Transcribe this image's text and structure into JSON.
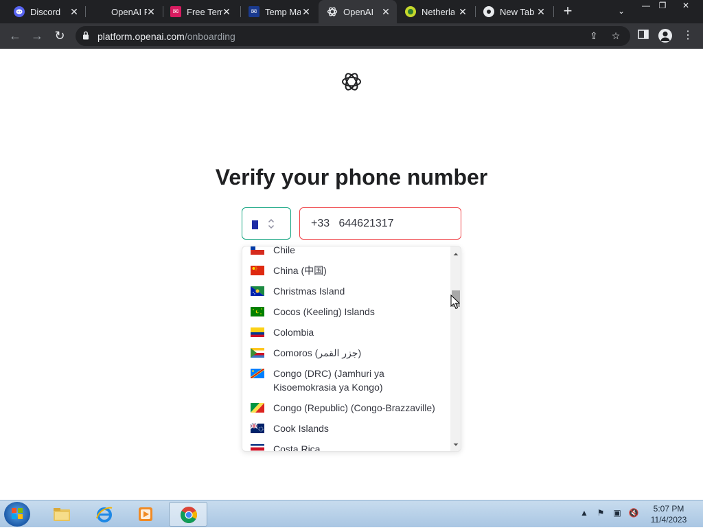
{
  "browser": {
    "tabs": [
      {
        "title": "Discord",
        "icon": "discord-icon",
        "icon_color": "#5865f2"
      },
      {
        "title": "OpenAI Platform",
        "icon": "openai-icon",
        "icon_color": "#202124"
      },
      {
        "title": "Free Temp Mail",
        "icon": "temp-mail-icon",
        "icon_color": "#d81b60"
      },
      {
        "title": "Temp Mail",
        "icon": "temp-mail-icon",
        "icon_color": "#1a3a8f"
      },
      {
        "title": "OpenAI Platform",
        "icon": "openai-icon",
        "icon_color": "#35363a"
      },
      {
        "title": "Netherlands",
        "icon": "globe-icon",
        "icon_color": "#c6d82c"
      },
      {
        "title": "New Tab",
        "icon": "chrome-icon",
        "icon_color": "#e8eaed"
      }
    ],
    "active_tab_index": 4,
    "address": {
      "host": "platform.openai.com",
      "path": "/onboarding"
    }
  },
  "page": {
    "heading": "Verify your phone number",
    "selected_country": "France",
    "phone_value": "+33   644621317",
    "countries": [
      {
        "name": "Chile",
        "flag_colors": [
          "#0039a6",
          "#ffffff",
          "#d52b1e"
        ]
      },
      {
        "name": "China (中国)",
        "flag_colors": [
          "#de2910",
          "#ffde00"
        ]
      },
      {
        "name": "Christmas Island",
        "flag_colors": [
          "#0021ad",
          "#1c8a42",
          "#ffc639"
        ]
      },
      {
        "name": "Cocos (Keeling) Islands",
        "flag_colors": [
          "#008000",
          "#ffe000"
        ]
      },
      {
        "name": "Colombia",
        "flag_colors": [
          "#fcd116",
          "#003893",
          "#ce1126"
        ]
      },
      {
        "name": "Comoros (جزر القمر)",
        "flag_colors": [
          "#ffc61e",
          "#ffffff",
          "#ce1126",
          "#3a75c4",
          "#3d8e33"
        ]
      },
      {
        "name": "Congo (DRC) (Jamhuri ya Kisoemokrasia ya Kongo)",
        "flag_colors": [
          "#007fff",
          "#f7d618",
          "#ce1021"
        ]
      },
      {
        "name": "Congo (Republic) (Congo-Brazzaville)",
        "flag_colors": [
          "#009543",
          "#fbde4a",
          "#dc241f"
        ]
      },
      {
        "name": "Cook Islands",
        "flag_colors": [
          "#012169",
          "#ffffff",
          "#c8102e"
        ]
      },
      {
        "name": "Costa Rica",
        "flag_colors": [
          "#002b7f",
          "#ffffff",
          "#ce1126"
        ]
      }
    ]
  },
  "taskbar": {
    "apps": [
      "windows-explorer",
      "internet-explorer",
      "media-player",
      "chrome"
    ],
    "time": "5:07 PM",
    "date": "11/4/2023"
  }
}
